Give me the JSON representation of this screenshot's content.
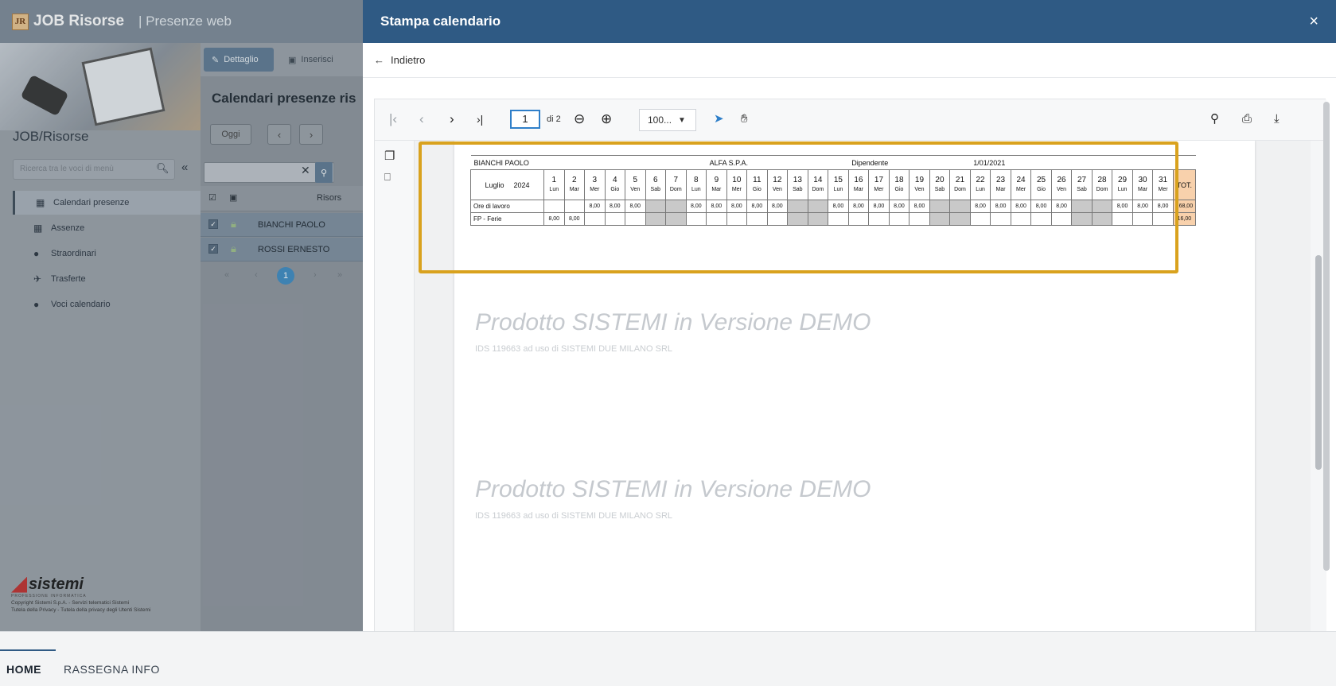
{
  "app": {
    "logo": "JR",
    "title": "JOB Risorse",
    "subtitle": "| Presenze web"
  },
  "sidebar": {
    "title": "JOB/Risorse",
    "search_placeholder": "Ricerca tra le voci di menù",
    "items": [
      {
        "label": "Calendari presenze",
        "icon": "calendar-icon",
        "active": true
      },
      {
        "label": "Assenze",
        "icon": "calendar-icon"
      },
      {
        "label": "Straordinari",
        "icon": "clock-icon"
      },
      {
        "label": "Trasferte",
        "icon": "plane-icon"
      },
      {
        "label": "Voci calendario",
        "icon": "dollar-icon"
      }
    ],
    "brand": "sistemi",
    "brand_tag": "PROFESSIONE INFORMATICA",
    "copyright": "Copyright Sistemi S.p.A. - Servizi telematici Sistemi",
    "privacy": "Tutela della Privacy - Tutela della privacy degli Utenti Sistemi"
  },
  "middle": {
    "btn_dettaglio": "Dettaglio",
    "btn_inserisci": "Inserisci",
    "title": "Calendari presenze ris",
    "btn_oggi": "Oggi",
    "col_risorsa": "Risors",
    "rows": [
      "BIANCHI PAOLO",
      "ROSSI ERNESTO"
    ],
    "page": "1"
  },
  "modal": {
    "title": "Stampa calendario",
    "close": "×",
    "back": "Indietro",
    "page_current": "1",
    "page_of": "di 2",
    "zoom": "100...",
    "calendar": {
      "employee": "BIANCHI PAOLO",
      "company": "ALFA S.P.A.",
      "role": "Dipendente",
      "date": "1/01/2021",
      "month": "Luglio",
      "year": "2024",
      "total_label": "TOT.",
      "days": [
        {
          "n": "1",
          "d": "Lun"
        },
        {
          "n": "2",
          "d": "Mar"
        },
        {
          "n": "3",
          "d": "Mer"
        },
        {
          "n": "4",
          "d": "Gio"
        },
        {
          "n": "5",
          "d": "Ven"
        },
        {
          "n": "6",
          "d": "Sab"
        },
        {
          "n": "7",
          "d": "Dom"
        },
        {
          "n": "8",
          "d": "Lun"
        },
        {
          "n": "9",
          "d": "Mar"
        },
        {
          "n": "10",
          "d": "Mer"
        },
        {
          "n": "11",
          "d": "Gio"
        },
        {
          "n": "12",
          "d": "Ven"
        },
        {
          "n": "13",
          "d": "Sab"
        },
        {
          "n": "14",
          "d": "Dom"
        },
        {
          "n": "15",
          "d": "Lun"
        },
        {
          "n": "16",
          "d": "Mar"
        },
        {
          "n": "17",
          "d": "Mer"
        },
        {
          "n": "18",
          "d": "Gio"
        },
        {
          "n": "19",
          "d": "Ven"
        },
        {
          "n": "20",
          "d": "Sab"
        },
        {
          "n": "21",
          "d": "Dom"
        },
        {
          "n": "22",
          "d": "Lun"
        },
        {
          "n": "23",
          "d": "Mar"
        },
        {
          "n": "24",
          "d": "Mer"
        },
        {
          "n": "25",
          "d": "Gio"
        },
        {
          "n": "26",
          "d": "Ven"
        },
        {
          "n": "27",
          "d": "Sab"
        },
        {
          "n": "28",
          "d": "Dom"
        },
        {
          "n": "29",
          "d": "Lun"
        },
        {
          "n": "30",
          "d": "Mar"
        },
        {
          "n": "31",
          "d": "Mer"
        }
      ],
      "rows": [
        {
          "label": "Ore di lavoro",
          "values": [
            "",
            "",
            "8,00",
            "8,00",
            "8,00",
            "",
            "",
            "8,00",
            "8,00",
            "8,00",
            "8,00",
            "8,00",
            "",
            "",
            "8,00",
            "8,00",
            "8,00",
            "8,00",
            "8,00",
            "",
            "",
            "8,00",
            "8,00",
            "8,00",
            "8,00",
            "8,00",
            "",
            "",
            "8,00",
            "8,00",
            "8,00"
          ],
          "total": "168,00"
        },
        {
          "label": "FP - Ferie",
          "values": [
            "8,00",
            "8,00",
            "",
            "",
            "",
            "",
            "",
            "",
            "",
            "",
            "",
            "",
            "",
            "",
            "",
            "",
            "",
            "",
            "",
            "",
            "",
            "",
            "",
            "",
            "",
            "",
            "",
            "",
            "",
            "",
            ""
          ],
          "total": "16,00"
        }
      ]
    },
    "watermark": "Prodotto SISTEMI in Versione DEMO",
    "watermark_sub": "IDS 119663 ad uso di SISTEMI DUE MILANO SRL"
  },
  "footer": {
    "tab_home": "HOME",
    "tab_info": "RASSEGNA INFO"
  },
  "colors": {
    "header_blue": "#2f5a84",
    "highlight": "#d9a21e",
    "weekend": "#c9c9c9",
    "total": "#f8d1ac"
  }
}
